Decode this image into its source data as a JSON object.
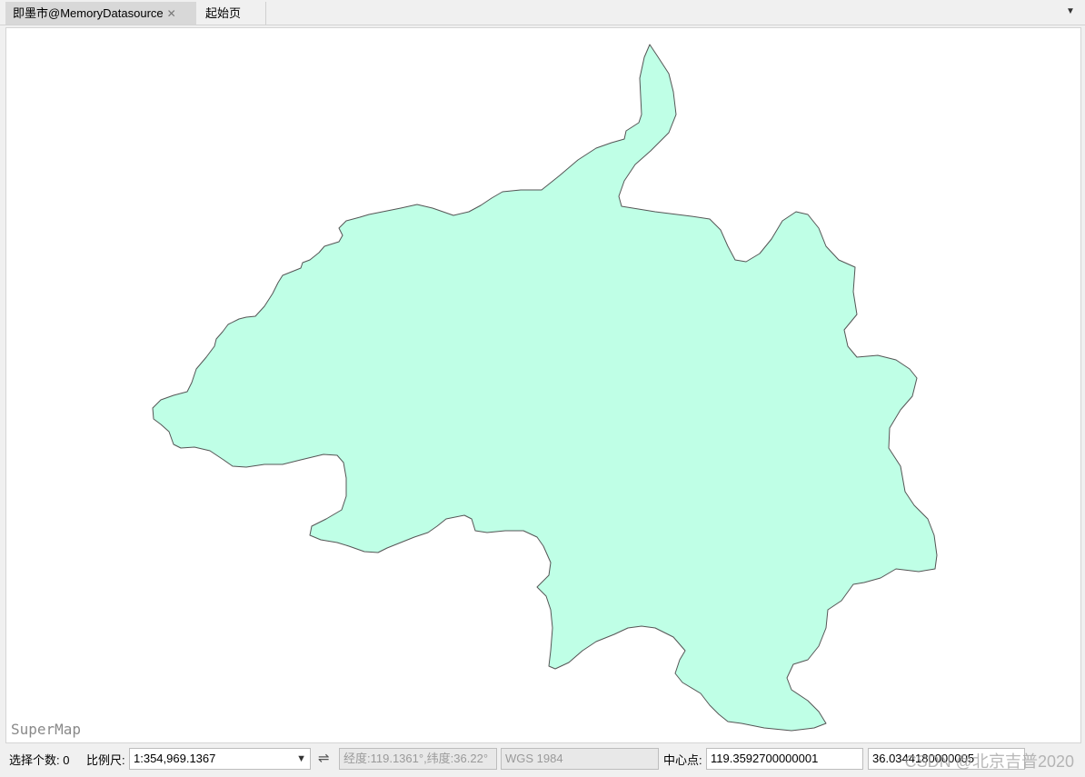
{
  "tabs": [
    {
      "label": "即墨市@MemoryDatasource",
      "active": true,
      "closable": true
    },
    {
      "label": "起始页",
      "active": false,
      "closable": false
    }
  ],
  "map": {
    "logo": "SuperMap",
    "region_fill": "#bfffe6",
    "region_stroke": "#555555"
  },
  "status": {
    "selection_label": "选择个数: 0",
    "scale_label": "比例尺:",
    "scale_value": "1:354,969.1367",
    "coord_readout": "经度:119.1361°,纬度:36.22°",
    "crs": "WGS 1984",
    "center_label": "中心点:",
    "center_x": "119.3592700000001",
    "center_y": "36.0344180000005"
  },
  "watermark": "CSDN @北京吉普2020"
}
